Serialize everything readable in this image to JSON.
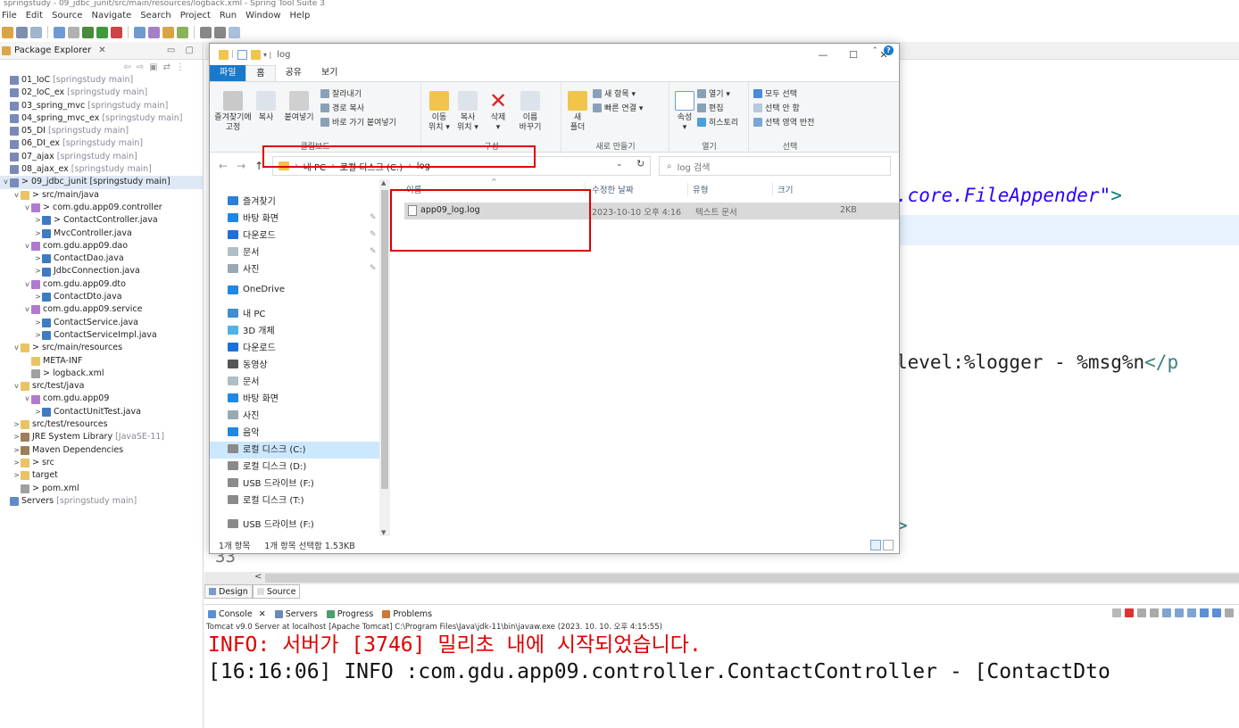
{
  "eclipse": {
    "title": "springstudy - 09_jdbc_junit/src/main/resources/logback.xml - Spring Tool Suite 3",
    "menu": [
      "File",
      "Edit",
      "Source",
      "Navigate",
      "Search",
      "Project",
      "Run",
      "Window",
      "Help"
    ],
    "package_explorer": {
      "tab_label": "Package Explorer",
      "tree": [
        {
          "label": "01_IoC",
          "dec": "[springstudy main]",
          "indent": 0,
          "icon": "project-icon",
          "tw": ""
        },
        {
          "label": "02_IoC_ex",
          "dec": "[springstudy main]",
          "indent": 0,
          "icon": "project-icon",
          "tw": ""
        },
        {
          "label": "03_spring_mvc",
          "dec": "[springstudy main]",
          "indent": 0,
          "icon": "project-icon",
          "tw": ""
        },
        {
          "label": "04_spring_mvc_ex",
          "dec": "[springstudy main]",
          "indent": 0,
          "icon": "project-icon",
          "tw": ""
        },
        {
          "label": "05_DI",
          "dec": "[springstudy main]",
          "indent": 0,
          "icon": "project-icon",
          "tw": ""
        },
        {
          "label": "06_DI_ex",
          "dec": "[springstudy main]",
          "indent": 0,
          "icon": "project-icon",
          "tw": ""
        },
        {
          "label": "07_ajax",
          "dec": "[springstudy main]",
          "indent": 0,
          "icon": "project-icon",
          "tw": ""
        },
        {
          "label": "08_ajax_ex",
          "dec": "[springstudy main]",
          "indent": 0,
          "icon": "project-icon",
          "tw": ""
        },
        {
          "label": "> 09_jdbc_junit [springstudy main]",
          "dec": "",
          "indent": 0,
          "icon": "project-icon",
          "tw": "v",
          "selected": true
        },
        {
          "label": "> src/main/java",
          "dec": "",
          "indent": 1,
          "icon": "folder-icon",
          "tw": "v"
        },
        {
          "label": "> com.gdu.app09.controller",
          "dec": "",
          "indent": 2,
          "icon": "package-icon",
          "tw": "v"
        },
        {
          "label": "> ContactController.java",
          "dec": "",
          "indent": 3,
          "icon": "java-file-icon",
          "tw": ">"
        },
        {
          "label": "MvcController.java",
          "dec": "",
          "indent": 3,
          "icon": "java-file-icon",
          "tw": ">"
        },
        {
          "label": "com.gdu.app09.dao",
          "dec": "",
          "indent": 2,
          "icon": "package-icon",
          "tw": "v"
        },
        {
          "label": "ContactDao.java",
          "dec": "",
          "indent": 3,
          "icon": "java-file-icon",
          "tw": ">"
        },
        {
          "label": "JdbcConnection.java",
          "dec": "",
          "indent": 3,
          "icon": "java-file-icon",
          "tw": ">"
        },
        {
          "label": "com.gdu.app09.dto",
          "dec": "",
          "indent": 2,
          "icon": "package-icon",
          "tw": "v"
        },
        {
          "label": "ContactDto.java",
          "dec": "",
          "indent": 3,
          "icon": "java-file-icon",
          "tw": ">"
        },
        {
          "label": "com.gdu.app09.service",
          "dec": "",
          "indent": 2,
          "icon": "package-icon",
          "tw": "v"
        },
        {
          "label": "ContactService.java",
          "dec": "",
          "indent": 3,
          "icon": "java-file-icon",
          "tw": ">"
        },
        {
          "label": "ContactServiceImpl.java",
          "dec": "",
          "indent": 3,
          "icon": "java-file-icon",
          "tw": ">"
        },
        {
          "label": "> src/main/resources",
          "dec": "",
          "indent": 1,
          "icon": "folder-icon",
          "tw": "v"
        },
        {
          "label": "META-INF",
          "dec": "",
          "indent": 2,
          "icon": "folder-icon",
          "tw": ""
        },
        {
          "label": "> logback.xml",
          "dec": "",
          "indent": 2,
          "icon": "xml-file-icon",
          "tw": ""
        },
        {
          "label": "src/test/java",
          "dec": "",
          "indent": 1,
          "icon": "folder-icon",
          "tw": "v"
        },
        {
          "label": "com.gdu.app09",
          "dec": "",
          "indent": 2,
          "icon": "package-icon",
          "tw": "v"
        },
        {
          "label": "ContactUnitTest.java",
          "dec": "",
          "indent": 3,
          "icon": "java-file-icon",
          "tw": ">"
        },
        {
          "label": "src/test/resources",
          "dec": "",
          "indent": 1,
          "icon": "folder-icon",
          "tw": ">"
        },
        {
          "label": "JRE System Library",
          "dec": "[JavaSE-11]",
          "indent": 1,
          "icon": "library-icon",
          "tw": ">"
        },
        {
          "label": "Maven Dependencies",
          "dec": "",
          "indent": 1,
          "icon": "library-icon",
          "tw": ">"
        },
        {
          "label": "> src",
          "dec": "",
          "indent": 1,
          "icon": "folder-icon",
          "tw": ">"
        },
        {
          "label": "target",
          "dec": "",
          "indent": 1,
          "icon": "folder-icon",
          "tw": ">"
        },
        {
          "label": "> pom.xml",
          "dec": "",
          "indent": 1,
          "icon": "xml-file-icon",
          "tw": ""
        },
        {
          "label": "Servers",
          "dec": "[springstudy main]",
          "indent": 0,
          "icon": "server-icon",
          "tw": ""
        }
      ]
    },
    "editor": {
      "code_line_a": ".core.FileAppender\"",
      "code_line_a_end": ">",
      "code_line_b": "level:%logger - %msg%n",
      "code_line_b_end": "</p",
      "code_line_c": ">",
      "line_number": "33",
      "tab_design": "Design",
      "tab_source": "Source"
    },
    "console": {
      "tabs": [
        "Console",
        "Servers",
        "Progress",
        "Problems"
      ],
      "path": "Tomcat v9.0 Server at localhost [Apache Tomcat] C:\\Program Files\\Java\\jdk-11\\bin\\javaw.exe  (2023. 10. 10. 오후 4:15:55)",
      "line1": "INFO: 서버가 [3746] 밀리초 내에 시작되었습니다.",
      "line2": "[16:16:06] INFO :com.gdu.app09.controller.ContactController - [ContactDto"
    }
  },
  "explorer": {
    "title": "log",
    "ribbon_tabs": [
      "파일",
      "홈",
      "공유",
      "보기"
    ],
    "ribbon": {
      "clipboard": {
        "pin": "즐겨찾기에\n고정",
        "copy": "복사",
        "paste": "붙여넣기",
        "cut": "잘라내기",
        "copy_path": "경로 복사",
        "paste_shortcut": "바로 가기 붙여넣기",
        "label": "클립보드"
      },
      "organize": {
        "move": "이동\n위치 ▾",
        "copyto": "복사\n위치 ▾",
        "delete": "삭제\n▾",
        "rename": "이름\n바꾸기",
        "label": "구성"
      },
      "new": {
        "folder": "새\n폴더",
        "new_item": "새 항목 ▾",
        "easy_access": "빠른 연결 ▾",
        "label": "새로 만들기"
      },
      "open": {
        "props": "속성\n▾",
        "open": "열기 ▾",
        "edit": "편집",
        "history": "히스토리",
        "label": "열기"
      },
      "select": {
        "all": "모두 선택",
        "none": "선택 안 함",
        "invert": "선택 영역 반전",
        "label": "선택"
      }
    },
    "address": {
      "crumbs": [
        "내 PC",
        "로컬 디스크 (C:)",
        "log"
      ]
    },
    "search_placeholder": "log 검색",
    "nav": {
      "favorites": "즐겨찾기",
      "items": [
        {
          "label": "바탕 화면",
          "icon": "desktop-icon",
          "pin": true
        },
        {
          "label": "다운로드",
          "icon": "download-icon",
          "pin": true
        },
        {
          "label": "문서",
          "icon": "document-icon",
          "pin": true
        },
        {
          "label": "사진",
          "icon": "picture-icon",
          "pin": true
        }
      ],
      "onedrive": "OneDrive",
      "thispc": "내 PC",
      "pc_items": [
        {
          "label": "3D 개체",
          "icon": "3d-objects-icon"
        },
        {
          "label": "다운로드",
          "icon": "download-icon"
        },
        {
          "label": "동영상",
          "icon": "video-icon"
        },
        {
          "label": "문서",
          "icon": "document-icon"
        },
        {
          "label": "바탕 화면",
          "icon": "desktop-icon"
        },
        {
          "label": "사진",
          "icon": "picture-icon"
        },
        {
          "label": "음악",
          "icon": "music-icon"
        },
        {
          "label": "로컬 디스크 (C:)",
          "icon": "drive-icon",
          "selected": true
        },
        {
          "label": "로컬 디스크 (D:)",
          "icon": "drive-icon"
        },
        {
          "label": "USB 드라이브 (F:)",
          "icon": "drive-icon"
        },
        {
          "label": "로컬 디스크 (T:)",
          "icon": "drive-icon"
        }
      ],
      "usb": "USB 드라이브 (F:)"
    },
    "columns": {
      "name": "이름",
      "date": "수정한 날짜",
      "type": "유형",
      "size": "크기"
    },
    "files": [
      {
        "name": "app09_log.log",
        "date": "2023-10-10 오후 4:16",
        "type": "텍스트 문서",
        "size": "2KB"
      }
    ],
    "status": {
      "count": "1개 항목",
      "selected": "1개 항목 선택함 1.53KB"
    }
  }
}
